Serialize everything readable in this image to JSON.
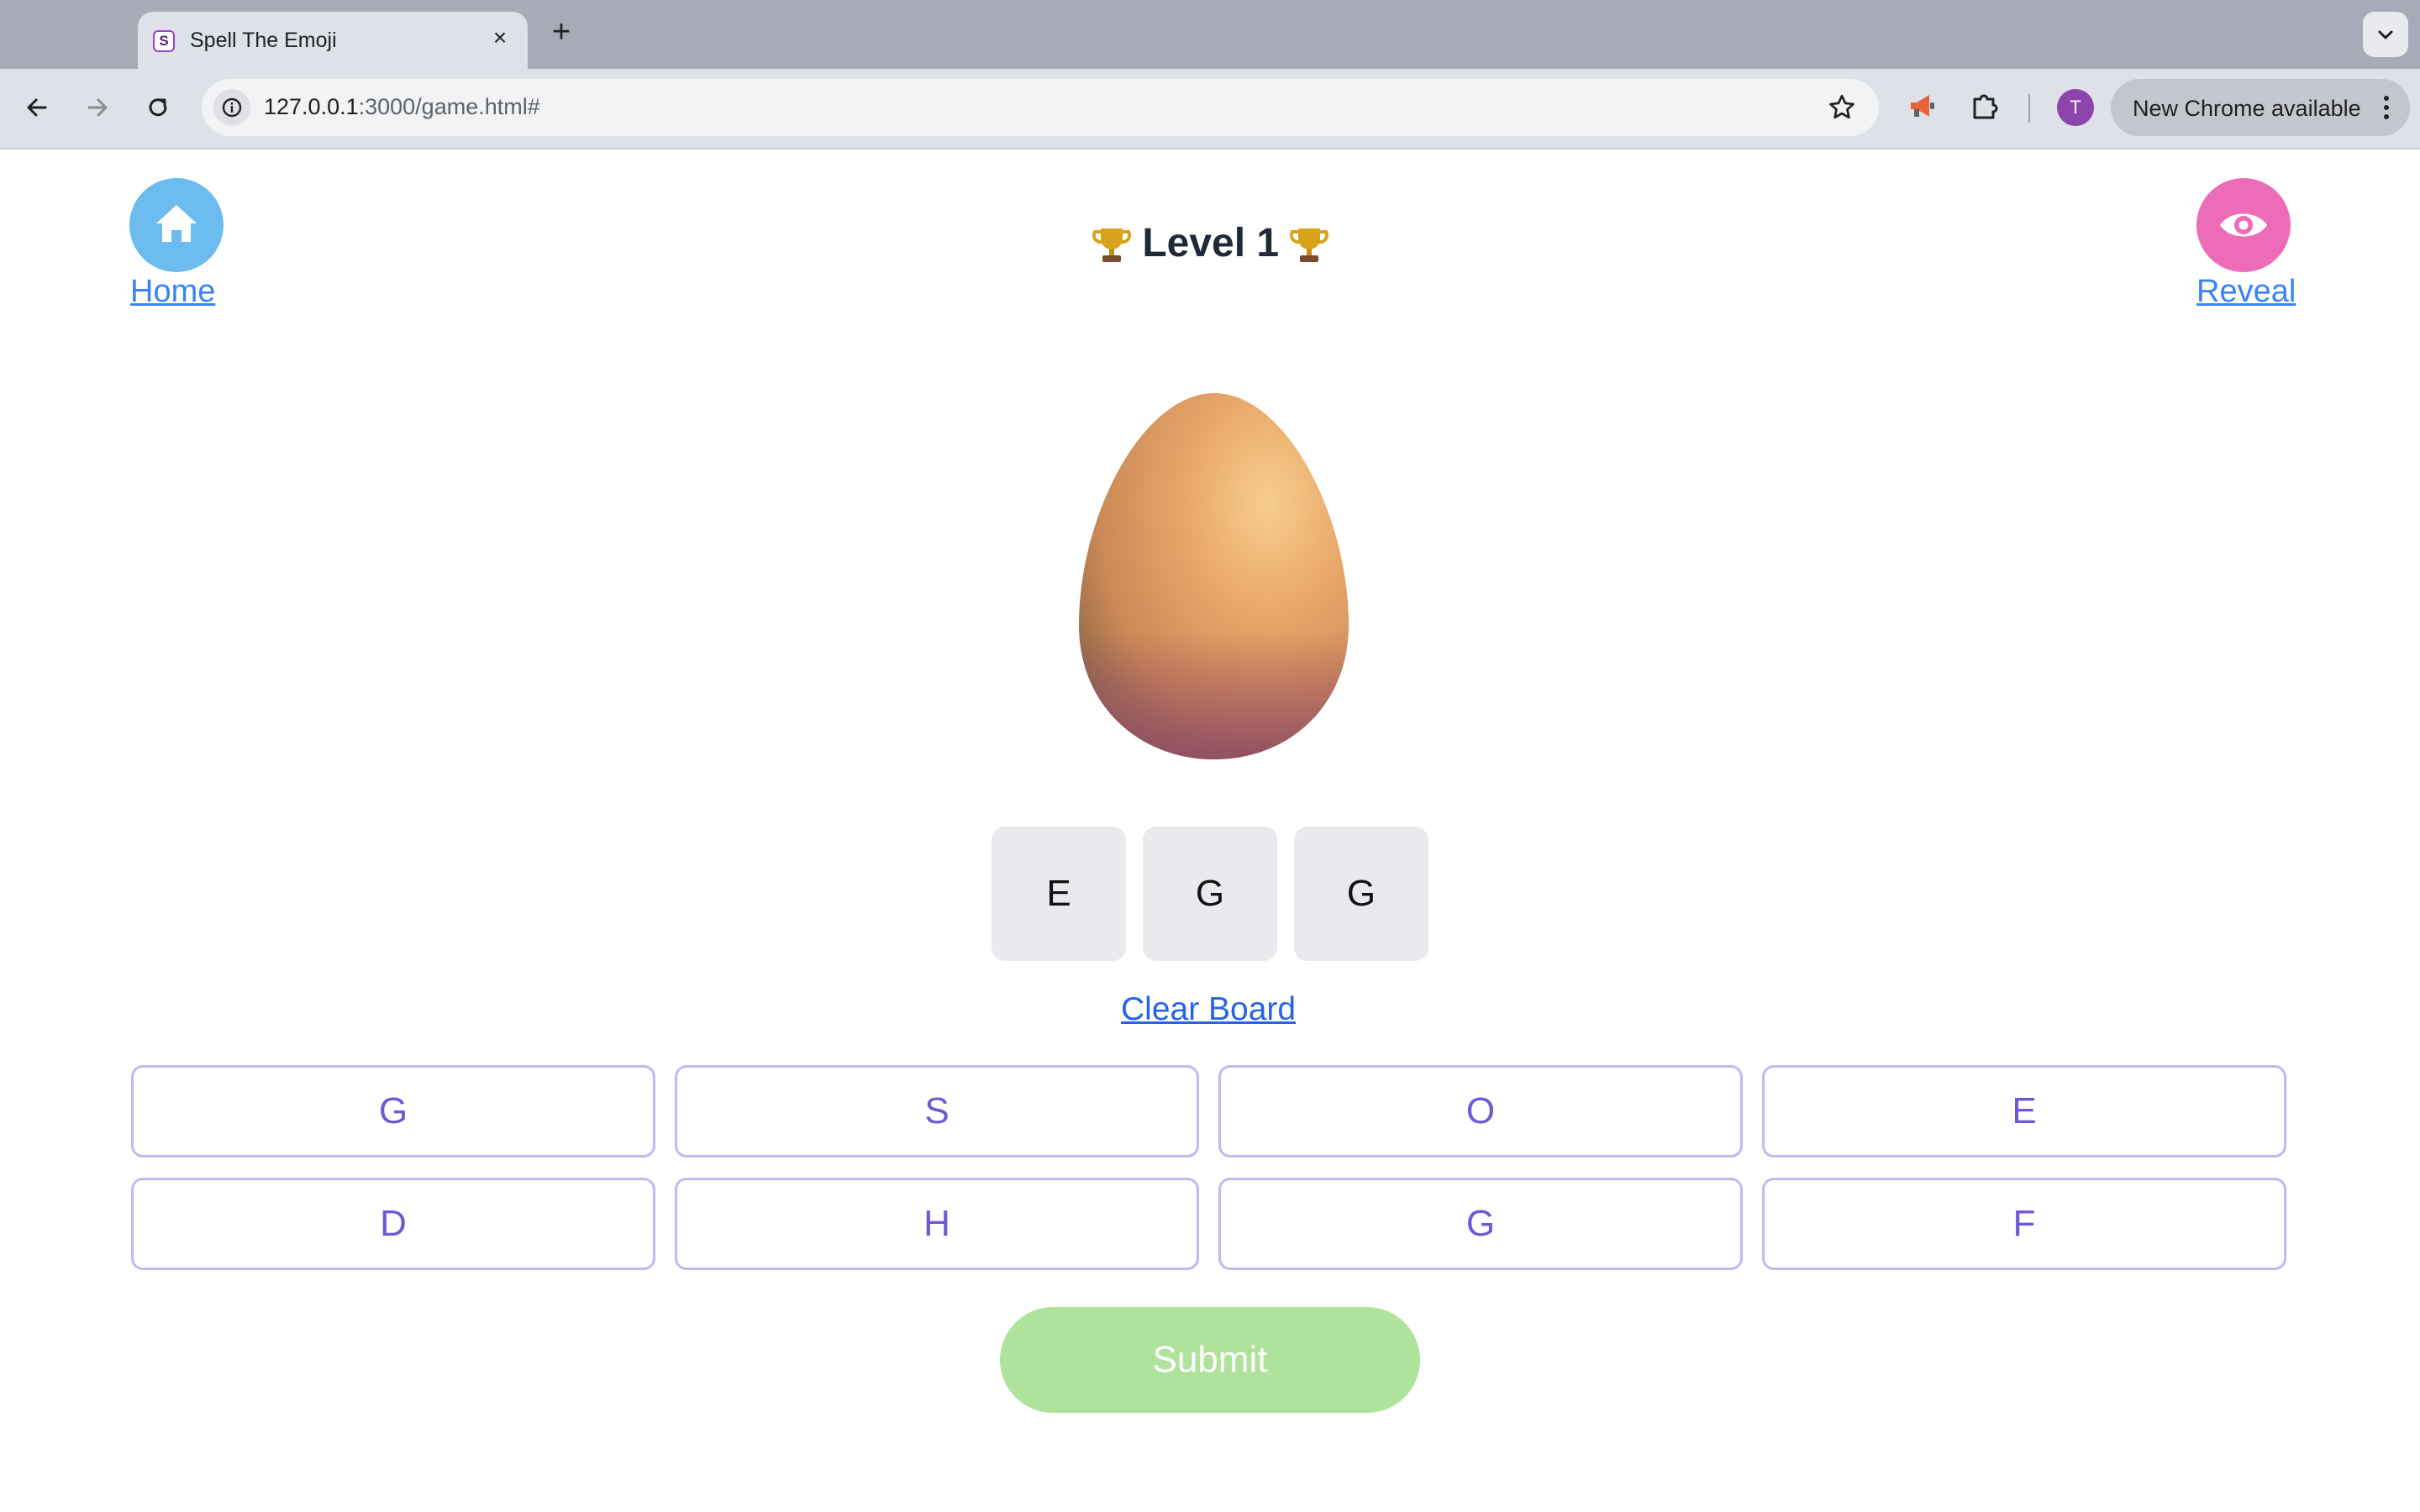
{
  "browser": {
    "tab_title": "Spell The Emoji",
    "tab_favicon_letter": "S",
    "url_host": "127.0.0.1",
    "url_rest": ":3000/game.html#",
    "avatar_initial": "T",
    "update_label": "New Chrome available"
  },
  "header": {
    "home_label": "Home",
    "reveal_label": "Reveal",
    "level_label": "Level 1",
    "trophy_emoji": "trophy"
  },
  "puzzle": {
    "emoji": "egg",
    "answer_slots": [
      "E",
      "G",
      "G"
    ]
  },
  "actions": {
    "clear_label": "Clear Board",
    "submit_label": "Submit"
  },
  "letter_bank": [
    "G",
    "S",
    "O",
    "E",
    "D",
    "H",
    "G",
    "F"
  ],
  "colors": {
    "home_button": "#6cbcef",
    "reveal_button": "#ec6cb7",
    "letter_text": "#7257d6",
    "letter_border": "#c3b8f0",
    "submit_bg": "#afe39b",
    "link": "#3b82f6"
  }
}
